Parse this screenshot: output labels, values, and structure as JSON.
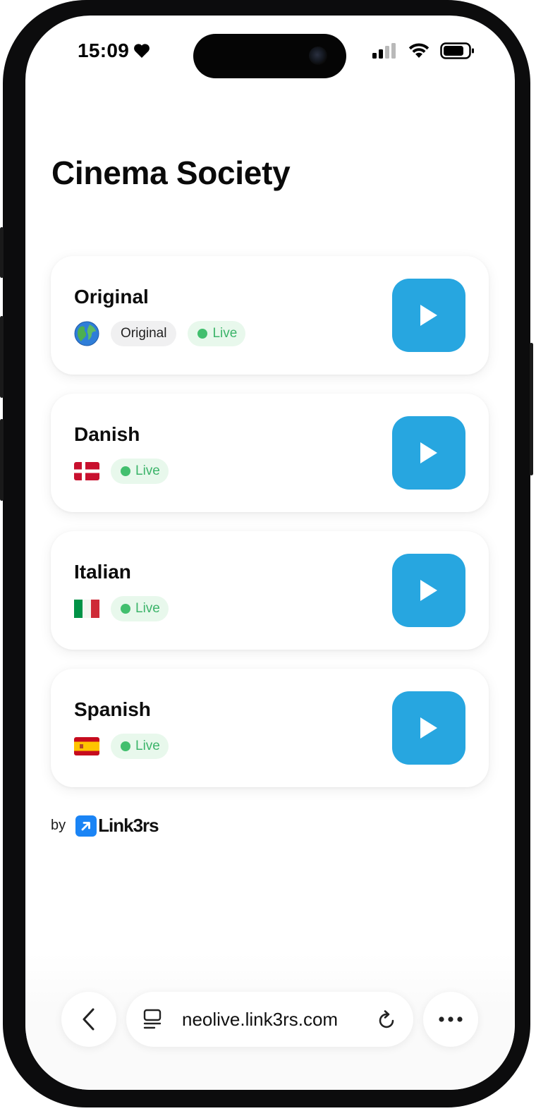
{
  "status_bar": {
    "time": "15:09"
  },
  "page": {
    "title": "Cinema Society"
  },
  "channels": [
    {
      "name": "Original",
      "flag": "globe-icon",
      "tag": "Original",
      "status": "Live"
    },
    {
      "name": "Danish",
      "flag": "denmark-flag-icon",
      "status": "Live"
    },
    {
      "name": "Italian",
      "flag": "italy-flag-icon",
      "status": "Live"
    },
    {
      "name": "Spanish",
      "flag": "spain-flag-icon",
      "status": "Live"
    }
  ],
  "footer": {
    "by": "by",
    "brand": "Link3rs"
  },
  "browser": {
    "url": "neolive.link3rs.com"
  },
  "colors": {
    "play_button": "#27a6e0",
    "live_text": "#3cb46a",
    "live_bg": "#e8f8ec",
    "brand_blue": "#1a84f5"
  }
}
